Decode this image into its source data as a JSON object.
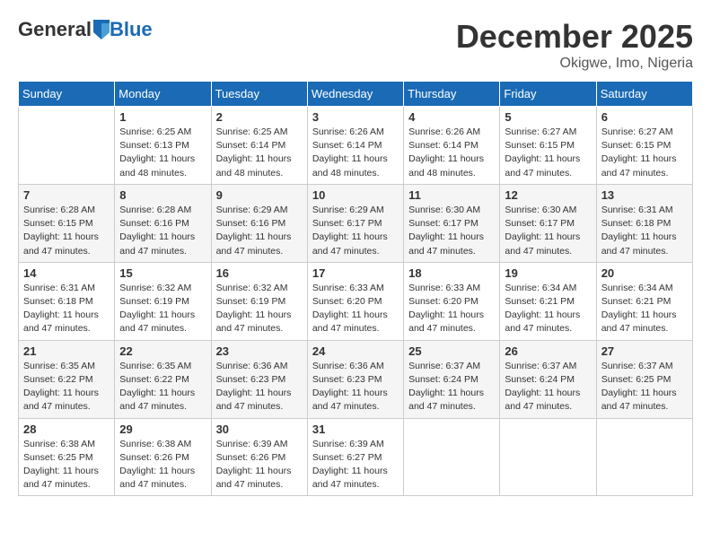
{
  "header": {
    "logo_general": "General",
    "logo_blue": "Blue",
    "month": "December 2025",
    "location": "Okigwe, Imo, Nigeria"
  },
  "days_of_week": [
    "Sunday",
    "Monday",
    "Tuesday",
    "Wednesday",
    "Thursday",
    "Friday",
    "Saturday"
  ],
  "weeks": [
    [
      {
        "day": "",
        "info": ""
      },
      {
        "day": "1",
        "info": "Sunrise: 6:25 AM\nSunset: 6:13 PM\nDaylight: 11 hours\nand 48 minutes."
      },
      {
        "day": "2",
        "info": "Sunrise: 6:25 AM\nSunset: 6:14 PM\nDaylight: 11 hours\nand 48 minutes."
      },
      {
        "day": "3",
        "info": "Sunrise: 6:26 AM\nSunset: 6:14 PM\nDaylight: 11 hours\nand 48 minutes."
      },
      {
        "day": "4",
        "info": "Sunrise: 6:26 AM\nSunset: 6:14 PM\nDaylight: 11 hours\nand 48 minutes."
      },
      {
        "day": "5",
        "info": "Sunrise: 6:27 AM\nSunset: 6:15 PM\nDaylight: 11 hours\nand 47 minutes."
      },
      {
        "day": "6",
        "info": "Sunrise: 6:27 AM\nSunset: 6:15 PM\nDaylight: 11 hours\nand 47 minutes."
      }
    ],
    [
      {
        "day": "7",
        "info": "Sunrise: 6:28 AM\nSunset: 6:15 PM\nDaylight: 11 hours\nand 47 minutes."
      },
      {
        "day": "8",
        "info": "Sunrise: 6:28 AM\nSunset: 6:16 PM\nDaylight: 11 hours\nand 47 minutes."
      },
      {
        "day": "9",
        "info": "Sunrise: 6:29 AM\nSunset: 6:16 PM\nDaylight: 11 hours\nand 47 minutes."
      },
      {
        "day": "10",
        "info": "Sunrise: 6:29 AM\nSunset: 6:17 PM\nDaylight: 11 hours\nand 47 minutes."
      },
      {
        "day": "11",
        "info": "Sunrise: 6:30 AM\nSunset: 6:17 PM\nDaylight: 11 hours\nand 47 minutes."
      },
      {
        "day": "12",
        "info": "Sunrise: 6:30 AM\nSunset: 6:17 PM\nDaylight: 11 hours\nand 47 minutes."
      },
      {
        "day": "13",
        "info": "Sunrise: 6:31 AM\nSunset: 6:18 PM\nDaylight: 11 hours\nand 47 minutes."
      }
    ],
    [
      {
        "day": "14",
        "info": "Sunrise: 6:31 AM\nSunset: 6:18 PM\nDaylight: 11 hours\nand 47 minutes."
      },
      {
        "day": "15",
        "info": "Sunrise: 6:32 AM\nSunset: 6:19 PM\nDaylight: 11 hours\nand 47 minutes."
      },
      {
        "day": "16",
        "info": "Sunrise: 6:32 AM\nSunset: 6:19 PM\nDaylight: 11 hours\nand 47 minutes."
      },
      {
        "day": "17",
        "info": "Sunrise: 6:33 AM\nSunset: 6:20 PM\nDaylight: 11 hours\nand 47 minutes."
      },
      {
        "day": "18",
        "info": "Sunrise: 6:33 AM\nSunset: 6:20 PM\nDaylight: 11 hours\nand 47 minutes."
      },
      {
        "day": "19",
        "info": "Sunrise: 6:34 AM\nSunset: 6:21 PM\nDaylight: 11 hours\nand 47 minutes."
      },
      {
        "day": "20",
        "info": "Sunrise: 6:34 AM\nSunset: 6:21 PM\nDaylight: 11 hours\nand 47 minutes."
      }
    ],
    [
      {
        "day": "21",
        "info": "Sunrise: 6:35 AM\nSunset: 6:22 PM\nDaylight: 11 hours\nand 47 minutes."
      },
      {
        "day": "22",
        "info": "Sunrise: 6:35 AM\nSunset: 6:22 PM\nDaylight: 11 hours\nand 47 minutes."
      },
      {
        "day": "23",
        "info": "Sunrise: 6:36 AM\nSunset: 6:23 PM\nDaylight: 11 hours\nand 47 minutes."
      },
      {
        "day": "24",
        "info": "Sunrise: 6:36 AM\nSunset: 6:23 PM\nDaylight: 11 hours\nand 47 minutes."
      },
      {
        "day": "25",
        "info": "Sunrise: 6:37 AM\nSunset: 6:24 PM\nDaylight: 11 hours\nand 47 minutes."
      },
      {
        "day": "26",
        "info": "Sunrise: 6:37 AM\nSunset: 6:24 PM\nDaylight: 11 hours\nand 47 minutes."
      },
      {
        "day": "27",
        "info": "Sunrise: 6:37 AM\nSunset: 6:25 PM\nDaylight: 11 hours\nand 47 minutes."
      }
    ],
    [
      {
        "day": "28",
        "info": "Sunrise: 6:38 AM\nSunset: 6:25 PM\nDaylight: 11 hours\nand 47 minutes."
      },
      {
        "day": "29",
        "info": "Sunrise: 6:38 AM\nSunset: 6:26 PM\nDaylight: 11 hours\nand 47 minutes."
      },
      {
        "day": "30",
        "info": "Sunrise: 6:39 AM\nSunset: 6:26 PM\nDaylight: 11 hours\nand 47 minutes."
      },
      {
        "day": "31",
        "info": "Sunrise: 6:39 AM\nSunset: 6:27 PM\nDaylight: 11 hours\nand 47 minutes."
      },
      {
        "day": "",
        "info": ""
      },
      {
        "day": "",
        "info": ""
      },
      {
        "day": "",
        "info": ""
      }
    ]
  ]
}
